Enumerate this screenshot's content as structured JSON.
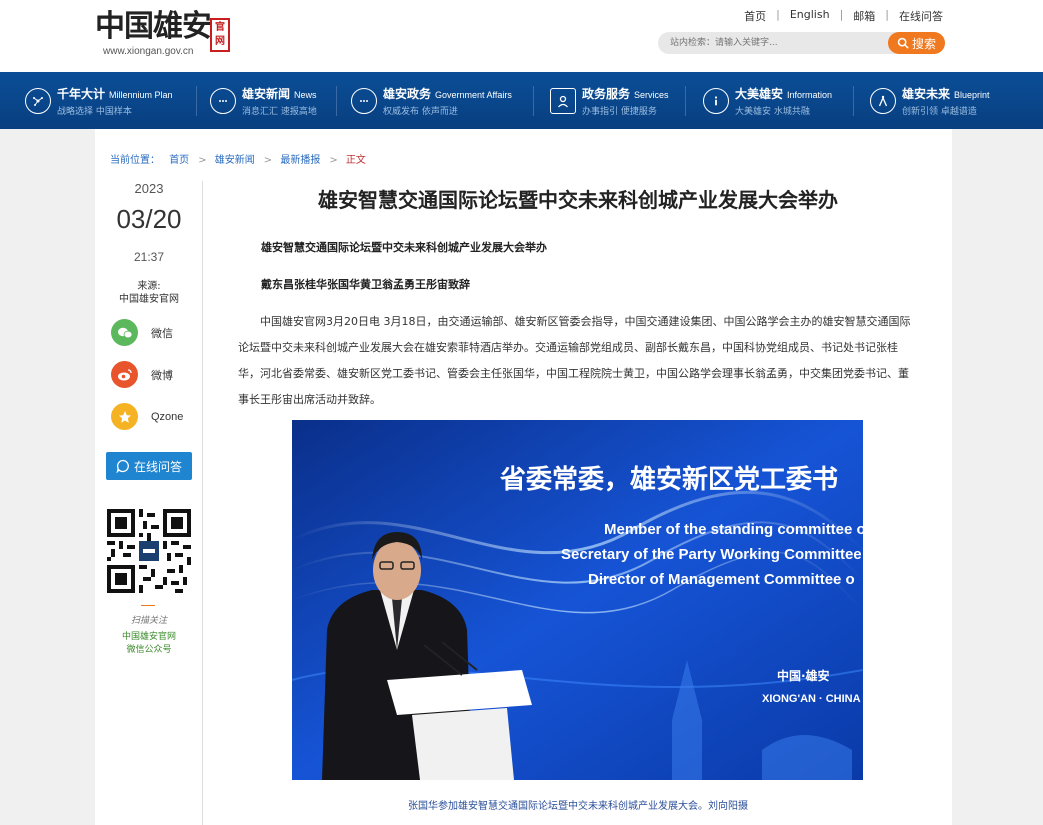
{
  "header": {
    "logo_text": "中国雄安",
    "logo_url": "www.xiongan.gov.cn",
    "logo_seal": "官网",
    "top_links": [
      "首页",
      "English",
      "邮箱",
      "在线问答"
    ],
    "search_placeholder": "站内检索：请输入关键字...",
    "search_button": "搜索"
  },
  "nav": {
    "items": [
      {
        "title": "千年大计",
        "en": "Millennium Plan",
        "sub": "战略选择 中国样本"
      },
      {
        "title": "雄安新闻",
        "en": "News",
        "sub": "消息汇汇 速报高地"
      },
      {
        "title": "雄安政务",
        "en": "Government Affairs",
        "sub": "权威发布 依声而进"
      },
      {
        "title": "政务服务",
        "en": "Services",
        "sub": "办事指引 便捷服务"
      },
      {
        "title": "大美雄安",
        "en": "Information",
        "sub": "大美雄安 水城共融"
      },
      {
        "title": "雄安未来",
        "en": "Blueprint",
        "sub": "创新引领 卓越谱造"
      }
    ]
  },
  "breadcrumb": {
    "label": "当前位置：",
    "items": [
      "首页",
      "雄安新闻",
      "最新播报",
      "正文"
    ]
  },
  "sidebar": {
    "year": "2023",
    "month_day": "03/20",
    "time": "21:37",
    "source_label": "来源:",
    "source_value": "中国雄安官网",
    "share": [
      {
        "label": "微信",
        "icon": "wechat-icon",
        "color": "#5cb85c"
      },
      {
        "label": "微博",
        "icon": "weibo-icon",
        "color": "#e8542c"
      },
      {
        "label": "Qzone",
        "icon": "qzone-icon",
        "color": "#f5b324"
      }
    ],
    "qa_button": "在线问答",
    "qr_caption1": "扫描关注",
    "qr_caption2": "中国雄安官网",
    "qr_caption3": "微信公众号"
  },
  "article": {
    "title": "雄安智慧交通国际论坛暨中交未来科创城产业发展大会举办",
    "subtitle": "雄安智慧交通国际论坛暨中交未来科创城产业发展大会举办",
    "authors": "戴东昌张桂华张国华黄卫翁孟勇王彤宙致辞",
    "body": "中国雄安官网3月20日电 3月18日，由交通运输部、雄安新区管委会指导，中国交通建设集团、中国公路学会主办的雄安智慧交通国际论坛暨中交未来科创城产业发展大会在雄安索菲特酒店举办。交通运输部党组成员、副部长戴东昌，中国科协党组成员、书记处书记张桂华，河北省委常委、雄安新区党工委书记、管委会主任张国华，中国工程院院士黄卫，中国公路学会理事长翁孟勇，中交集团党委书记、董事长王彤宙出席活动并致辞。",
    "photo": {
      "screen_cn": "省委常委，雄安新区党工委书",
      "screen_en_lines": [
        "Member of the standing committee o",
        "Secretary of the Party Working Committee",
        "Director of Management Committee o"
      ],
      "logo_cn": "中国·雄安",
      "logo_en": "XIONG'AN · CHINA"
    },
    "caption": "张国华参加雄安智慧交通国际论坛暨中交未来科创城产业发展大会。刘向阳摄"
  },
  "colors": {
    "nav_bg": "#0b4e97",
    "accent_orange": "#f0781e",
    "link_blue": "#2a6cbf",
    "qa_blue": "#1f85d1"
  }
}
